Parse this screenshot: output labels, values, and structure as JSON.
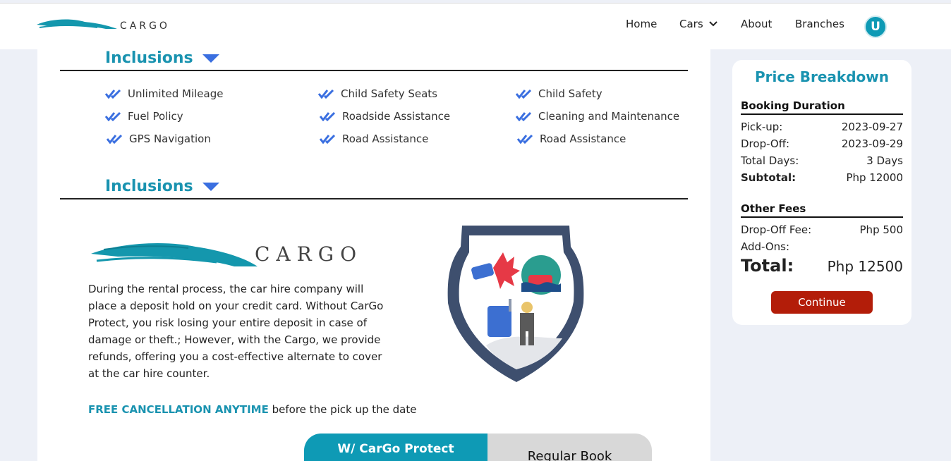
{
  "brand": {
    "name": "CarGo",
    "logo_text": "CARGO"
  },
  "nav": {
    "home": "Home",
    "cars": "Cars",
    "about": "About",
    "branches": "Branches",
    "avatar_initial": "U"
  },
  "inclusions": {
    "heading": "Inclusions",
    "items": [
      "Unlimited Mileage",
      "Child Safety Seats",
      "Child Safety",
      "Fuel Policy",
      "Roadside Assistance",
      "Cleaning and Maintenance",
      "GPS Navigation",
      "Road Assistance",
      "Road Assistance"
    ]
  },
  "protect": {
    "heading": "Inclusions",
    "logo_text": "CARGO",
    "description": "During the rental process, the car hire company will place a deposit hold on your credit card. Without CarGo Protect, you risk losing your entire deposit in case of damage or theft.; However, with the Cargo, we provide refunds, offering you a cost-effective alternate to cover at the car hire counter.",
    "free_highlight": "FREE CANCELLATION ANYTIME",
    "free_rest": "before the pick up the date",
    "tab_protect": "W/ CarGo Protect",
    "tab_regular": "Regular Book"
  },
  "price": {
    "title": "Price Breakdown",
    "booking_heading": "Booking Duration",
    "pickup_label": "Pick-up:",
    "pickup_value": "2023-09-27",
    "dropoff_label": "Drop-Off:",
    "dropoff_value": "2023-09-29",
    "days_label": "Total Days:",
    "days_value": "3 Days",
    "subtotal_label": "Subtotal:",
    "subtotal_value": "Php 12000",
    "other_heading": "Other Fees",
    "fee_label": "Drop-Off Fee:",
    "fee_value": "Php 500",
    "addons_label": "Add-Ons:",
    "total_label": "Total:",
    "total_value": "Php 12500",
    "continue_label": "Continue"
  },
  "colors": {
    "accent": "#1a93b0",
    "button": "#b31d09",
    "page_bg": "#edf0f7"
  }
}
